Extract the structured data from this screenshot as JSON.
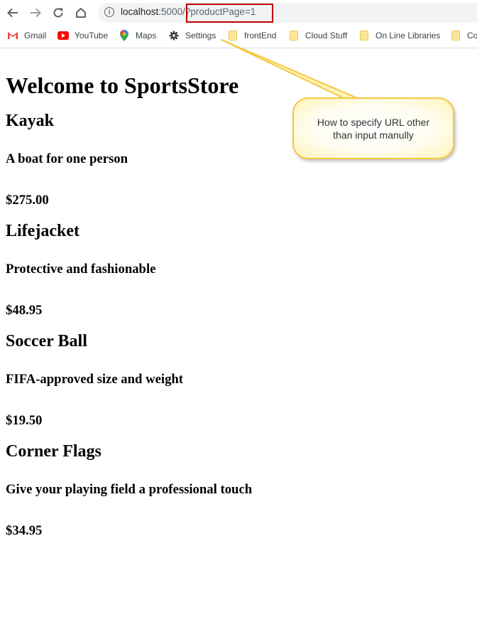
{
  "browser": {
    "url_host": "localhost",
    "url_port": ":5000",
    "url_path": "/?productPage=1",
    "bookmarks": [
      {
        "label": "Gmail",
        "icon": "gmail-icon"
      },
      {
        "label": "YouTube",
        "icon": "youtube-icon"
      },
      {
        "label": "Maps",
        "icon": "maps-icon"
      },
      {
        "label": "Settings",
        "icon": "gear-icon"
      },
      {
        "label": "frontEnd",
        "icon": "folder-icon"
      },
      {
        "label": "Cloud Stuff",
        "icon": "folder-icon"
      },
      {
        "label": "On Line Libraries",
        "icon": "folder-icon"
      },
      {
        "label": "Co",
        "icon": "folder-icon"
      }
    ]
  },
  "page": {
    "title": "Welcome to SportsStore",
    "products": [
      {
        "name": "Kayak",
        "description": "A boat for one person",
        "price": "$275.00"
      },
      {
        "name": "Lifejacket",
        "description": "Protective and fashionable",
        "price": "$48.95"
      },
      {
        "name": "Soccer Ball",
        "description": "FIFA-approved size and weight",
        "price": "$19.50"
      },
      {
        "name": "Corner Flags",
        "description": "Give your playing field a professional touch",
        "price": "$34.95"
      }
    ]
  },
  "annotation": {
    "callout_text": "How to specify URL other than input manully",
    "highlight_color": "#c00000",
    "callout_border_color": "#f5c842"
  }
}
